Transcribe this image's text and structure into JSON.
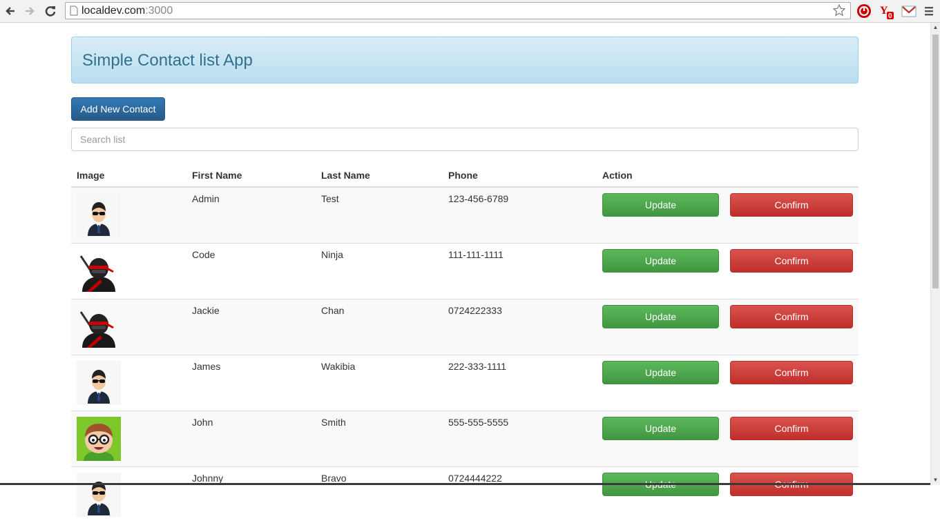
{
  "browser": {
    "url_host": "localdev.com",
    "url_port": ":3000",
    "ext_badge": "0"
  },
  "app": {
    "title": "Simple Contact list App",
    "add_button": "Add New Contact",
    "search_placeholder": "Search list"
  },
  "table": {
    "headers": [
      "Image",
      "First Name",
      "Last Name",
      "Phone",
      "Action"
    ],
    "update_label": "Update",
    "confirm_label": "Confirm",
    "rows": [
      {
        "avatar": "agent",
        "first": "Admin",
        "last": "Test",
        "phone": "123-456-6789"
      },
      {
        "avatar": "ninja",
        "first": "Code",
        "last": "Ninja",
        "phone": "111-111-1111"
      },
      {
        "avatar": "ninja",
        "first": "Jackie",
        "last": "Chan",
        "phone": "0724222333"
      },
      {
        "avatar": "agent",
        "first": "James",
        "last": "Wakibia",
        "phone": "222-333-1111"
      },
      {
        "avatar": "nerd",
        "first": "John",
        "last": "Smith",
        "phone": "555-555-5555"
      },
      {
        "avatar": "agent",
        "first": "Johnny",
        "last": "Bravo",
        "phone": "0724444222"
      }
    ]
  },
  "colors": {
    "primary": "#337ab7",
    "success": "#5cb85c",
    "danger": "#d9534f",
    "jumbo_bg": "#d9edf7",
    "jumbo_text": "#31708f"
  }
}
